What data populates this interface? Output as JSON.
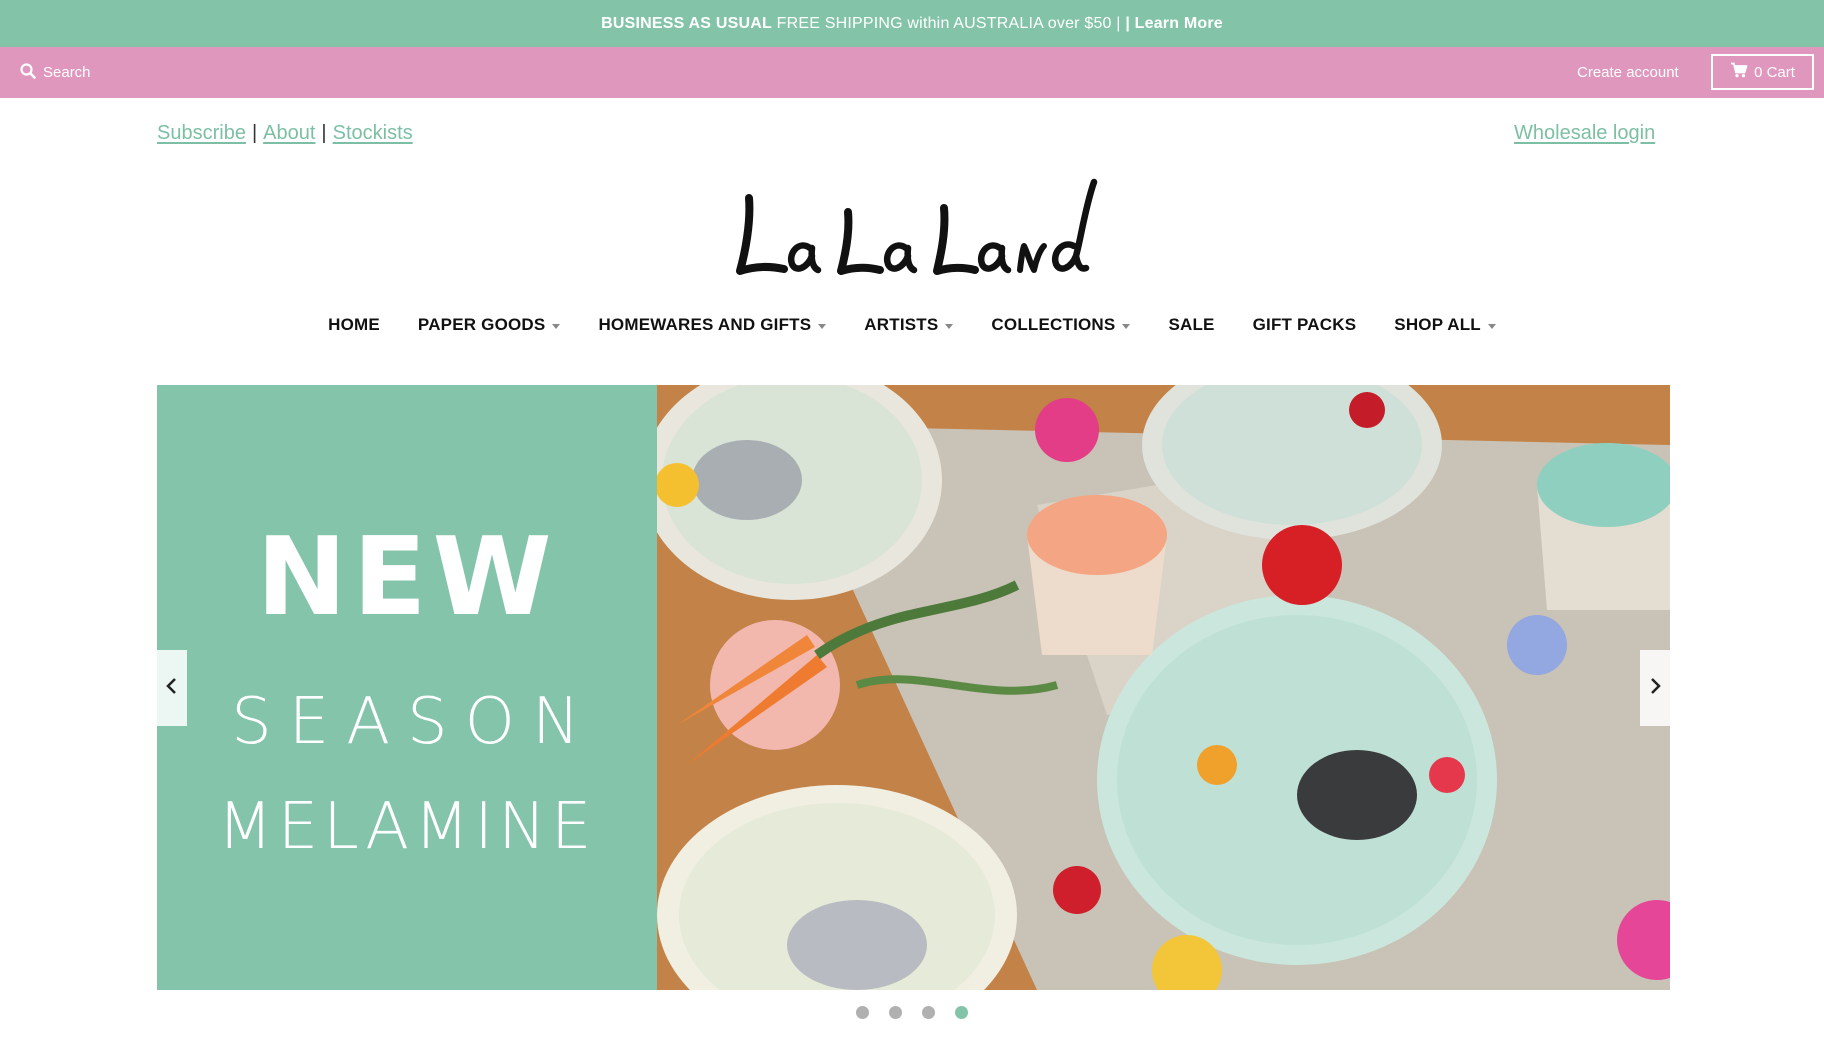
{
  "announcement": {
    "bold_lead": "BUSINESS AS USUAL",
    "message": "FREE SHIPPING within AUSTRALIA over $50 |",
    "link": "| Learn More"
  },
  "topbar": {
    "search_label": "Search",
    "create_account": "Create account",
    "cart_label": "0 Cart",
    "search_icon": "search-icon",
    "cart_icon": "cart-icon"
  },
  "utility_links": {
    "subscribe": "Subscribe",
    "about": "About",
    "stockists": "Stockists",
    "separator": "|",
    "wholesale": "Wholesale login"
  },
  "logo": {
    "text": "La La Land"
  },
  "nav": {
    "items": [
      {
        "label": "HOME",
        "has_dropdown": false
      },
      {
        "label": "PAPER GOODS",
        "has_dropdown": true
      },
      {
        "label": "HOMEWARES AND GIFTS",
        "has_dropdown": true
      },
      {
        "label": "ARTISTS",
        "has_dropdown": true
      },
      {
        "label": "COLLECTIONS",
        "has_dropdown": true
      },
      {
        "label": "SALE",
        "has_dropdown": false
      },
      {
        "label": "GIFT PACKS",
        "has_dropdown": false
      },
      {
        "label": "SHOP ALL",
        "has_dropdown": true
      }
    ]
  },
  "hero": {
    "line1": "NEW",
    "line2": "SEASON",
    "line3": "MELAMINE",
    "slide_count": 4,
    "active_slide": 4
  },
  "colors": {
    "accent_green": "#83c4a9",
    "topbar_pink": "#df97bd",
    "link_green": "#7dbfa4"
  }
}
